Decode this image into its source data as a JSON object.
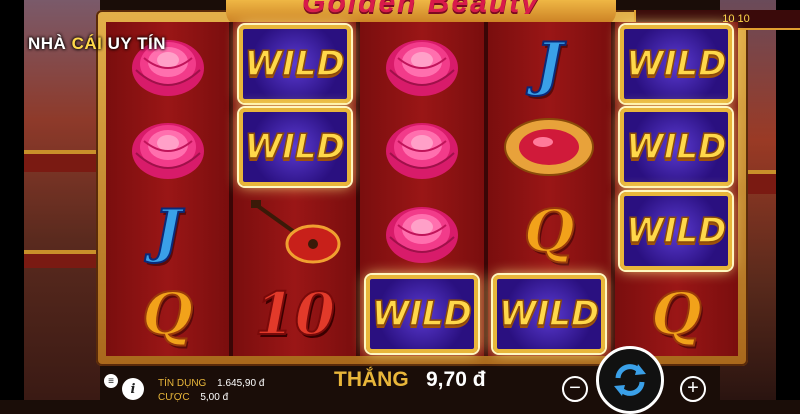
{
  "watermark": {
    "part1": "NHÀ",
    "part2": "CÁI",
    "part3": "UY TÍN"
  },
  "game": {
    "title": "Golden Beauty",
    "win_box_text": "10 10"
  },
  "reels": [
    [
      "peony",
      "peony",
      "J",
      "Q"
    ],
    [
      "WILD",
      "WILD",
      "pipa",
      "10"
    ],
    [
      "peony",
      "peony",
      "peony",
      "WILD"
    ],
    [
      "J",
      "ruby",
      "Q",
      "WILD"
    ],
    [
      "WILD",
      "WILD",
      "WILD",
      "Q"
    ]
  ],
  "wild_label": "WILD",
  "status": {
    "credit_label": "TÍN DỤNG",
    "credit_value": "1.645,90 đ",
    "bet_label": "CƯỢC",
    "bet_value": "5,00 đ",
    "win_label": "THẮNG",
    "win_value": "9,70 đ"
  },
  "controls": {
    "minus": "−",
    "plus": "+",
    "menu": "≡",
    "info": "i"
  },
  "icons": [
    "menu-icon",
    "info-icon",
    "spin-icon",
    "minus-icon",
    "plus-icon"
  ],
  "colors": {
    "gold": "#e8b63a",
    "wild_bg": "#2a1080",
    "reel_bg": "#9a1616"
  }
}
